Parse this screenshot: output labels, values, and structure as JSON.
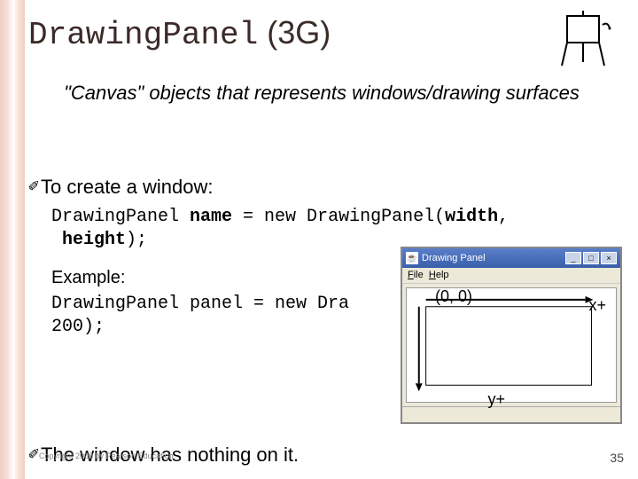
{
  "title": {
    "mono": "DrawingPanel",
    "rest": " (3G)"
  },
  "subtitle": "\"Canvas\" objects that represents windows/drawing surfaces",
  "bullet1": "To create a window:",
  "syntax": {
    "line1a": "DrawingPanel ",
    "name": "name",
    "line1b": " = new DrawingPanel(",
    "width": "width",
    "comma": ", ",
    "height": "height",
    "line1c": ");"
  },
  "exampleLabel": "Example:",
  "exampleCode": {
    "l1": "DrawingPanel panel = new Dra",
    "l2": " 200);"
  },
  "window": {
    "title": "Drawing Panel",
    "menuFile": "File",
    "menuHelp": "Help",
    "btnMin": "_",
    "btnMax": "□",
    "btnClose": "×"
  },
  "coords": {
    "origin": "(0, 0)",
    "xplus": "x+",
    "yplus": "y+"
  },
  "bullet2": "The window has nothing on it.",
  "copyright": "Copyright 2008 by Pearson Education",
  "page": "35"
}
